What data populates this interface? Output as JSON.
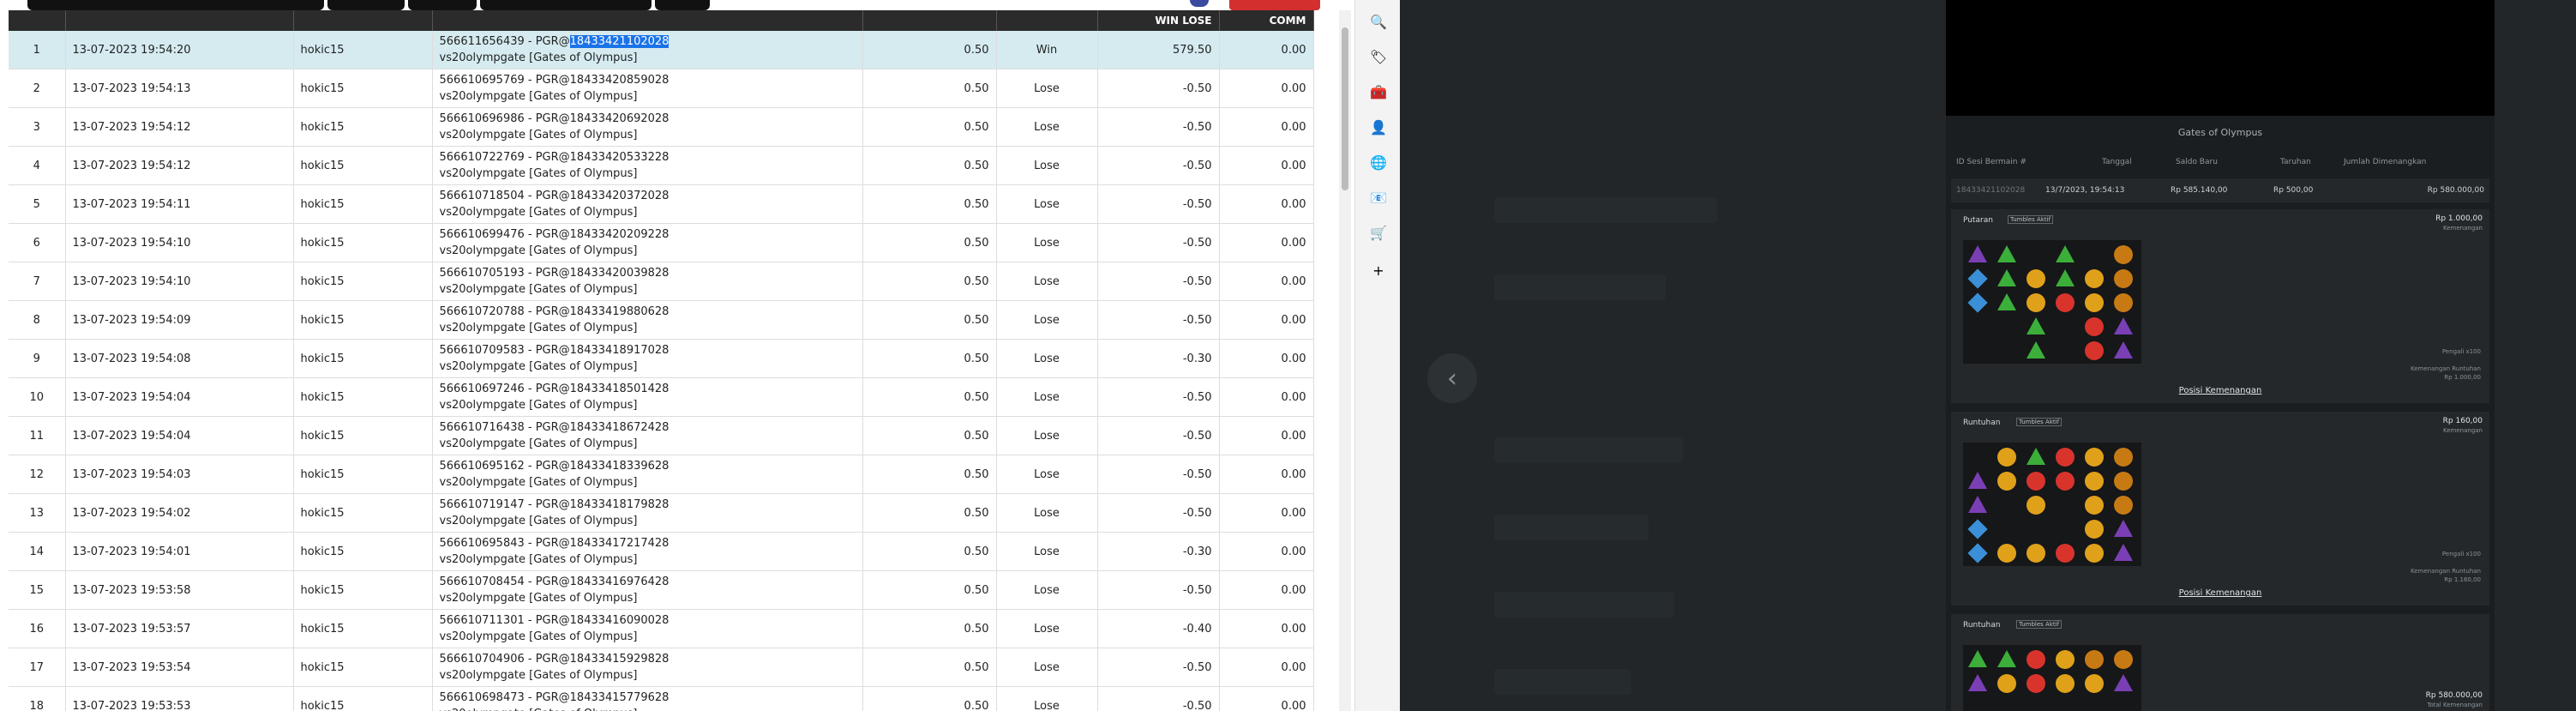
{
  "table": {
    "headers": {
      "no": "",
      "date": "",
      "user": "",
      "desc": "",
      "bet": "",
      "result": "",
      "win_lose": "WIN LOSE",
      "comm": "COMM"
    },
    "rows": [
      {
        "no": "1",
        "date": "13-07-2023 19:54:20",
        "user": "hokic15",
        "desc_pre": "566611656439 - PGR@",
        "desc_sel": "18433421102028",
        "desc_line2": "vs20olympgate [Gates of Olympus]",
        "bet": "0.50",
        "result": "Win",
        "win_lose": "579.50",
        "comm": "0.00"
      },
      {
        "no": "2",
        "date": "13-07-2023 19:54:13",
        "user": "hokic15",
        "desc_pre": "566610695769 - PGR@18433420859028",
        "desc_sel": "",
        "desc_line2": "vs20olympgate [Gates of Olympus]",
        "bet": "0.50",
        "result": "Lose",
        "win_lose": "-0.50",
        "comm": "0.00"
      },
      {
        "no": "3",
        "date": "13-07-2023 19:54:12",
        "user": "hokic15",
        "desc_pre": "566610696986 - PGR@18433420692028",
        "desc_sel": "",
        "desc_line2": "vs20olympgate [Gates of Olympus]",
        "bet": "0.50",
        "result": "Lose",
        "win_lose": "-0.50",
        "comm": "0.00"
      },
      {
        "no": "4",
        "date": "13-07-2023 19:54:12",
        "user": "hokic15",
        "desc_pre": "566610722769 - PGR@18433420533228",
        "desc_sel": "",
        "desc_line2": "vs20olympgate [Gates of Olympus]",
        "bet": "0.50",
        "result": "Lose",
        "win_lose": "-0.50",
        "comm": "0.00"
      },
      {
        "no": "5",
        "date": "13-07-2023 19:54:11",
        "user": "hokic15",
        "desc_pre": "566610718504 - PGR@18433420372028",
        "desc_sel": "",
        "desc_line2": "vs20olympgate [Gates of Olympus]",
        "bet": "0.50",
        "result": "Lose",
        "win_lose": "-0.50",
        "comm": "0.00"
      },
      {
        "no": "6",
        "date": "13-07-2023 19:54:10",
        "user": "hokic15",
        "desc_pre": "566610699476 - PGR@18433420209228",
        "desc_sel": "",
        "desc_line2": "vs20olympgate [Gates of Olympus]",
        "bet": "0.50",
        "result": "Lose",
        "win_lose": "-0.50",
        "comm": "0.00"
      },
      {
        "no": "7",
        "date": "13-07-2023 19:54:10",
        "user": "hokic15",
        "desc_pre": "566610705193 - PGR@18433420039828",
        "desc_sel": "",
        "desc_line2": "vs20olympgate [Gates of Olympus]",
        "bet": "0.50",
        "result": "Lose",
        "win_lose": "-0.50",
        "comm": "0.00"
      },
      {
        "no": "8",
        "date": "13-07-2023 19:54:09",
        "user": "hokic15",
        "desc_pre": "566610720788 - PGR@18433419880628",
        "desc_sel": "",
        "desc_line2": "vs20olympgate [Gates of Olympus]",
        "bet": "0.50",
        "result": "Lose",
        "win_lose": "-0.50",
        "comm": "0.00"
      },
      {
        "no": "9",
        "date": "13-07-2023 19:54:08",
        "user": "hokic15",
        "desc_pre": "566610709583 - PGR@18433418917028",
        "desc_sel": "",
        "desc_line2": "vs20olympgate [Gates of Olympus]",
        "bet": "0.50",
        "result": "Lose",
        "win_lose": "-0.30",
        "comm": "0.00"
      },
      {
        "no": "10",
        "date": "13-07-2023 19:54:04",
        "user": "hokic15",
        "desc_pre": "566610697246 - PGR@18433418501428",
        "desc_sel": "",
        "desc_line2": "vs20olympgate [Gates of Olympus]",
        "bet": "0.50",
        "result": "Lose",
        "win_lose": "-0.50",
        "comm": "0.00"
      },
      {
        "no": "11",
        "date": "13-07-2023 19:54:04",
        "user": "hokic15",
        "desc_pre": "566610716438 - PGR@18433418672428",
        "desc_sel": "",
        "desc_line2": "vs20olympgate [Gates of Olympus]",
        "bet": "0.50",
        "result": "Lose",
        "win_lose": "-0.50",
        "comm": "0.00"
      },
      {
        "no": "12",
        "date": "13-07-2023 19:54:03",
        "user": "hokic15",
        "desc_pre": "566610695162 - PGR@18433418339628",
        "desc_sel": "",
        "desc_line2": "vs20olympgate [Gates of Olympus]",
        "bet": "0.50",
        "result": "Lose",
        "win_lose": "-0.50",
        "comm": "0.00"
      },
      {
        "no": "13",
        "date": "13-07-2023 19:54:02",
        "user": "hokic15",
        "desc_pre": "566610719147 - PGR@18433418179828",
        "desc_sel": "",
        "desc_line2": "vs20olympgate [Gates of Olympus]",
        "bet": "0.50",
        "result": "Lose",
        "win_lose": "-0.50",
        "comm": "0.00"
      },
      {
        "no": "14",
        "date": "13-07-2023 19:54:01",
        "user": "hokic15",
        "desc_pre": "566610695843 - PGR@18433417217428",
        "desc_sel": "",
        "desc_line2": "vs20olympgate [Gates of Olympus]",
        "bet": "0.50",
        "result": "Lose",
        "win_lose": "-0.30",
        "comm": "0.00"
      },
      {
        "no": "15",
        "date": "13-07-2023 19:53:58",
        "user": "hokic15",
        "desc_pre": "566610708454 - PGR@18433416976428",
        "desc_sel": "",
        "desc_line2": "vs20olympgate [Gates of Olympus]",
        "bet": "0.50",
        "result": "Lose",
        "win_lose": "-0.50",
        "comm": "0.00"
      },
      {
        "no": "16",
        "date": "13-07-2023 19:53:57",
        "user": "hokic15",
        "desc_pre": "566610711301 - PGR@18433416090028",
        "desc_sel": "",
        "desc_line2": "vs20olympgate [Gates of Olympus]",
        "bet": "0.50",
        "result": "Lose",
        "win_lose": "-0.40",
        "comm": "0.00"
      },
      {
        "no": "17",
        "date": "13-07-2023 19:53:54",
        "user": "hokic15",
        "desc_pre": "566610704906 - PGR@18433415929828",
        "desc_sel": "",
        "desc_line2": "vs20olympgate [Gates of Olympus]",
        "bet": "0.50",
        "result": "Lose",
        "win_lose": "-0.50",
        "comm": "0.00"
      },
      {
        "no": "18",
        "date": "13-07-2023 19:53:53",
        "user": "hokic15",
        "desc_pre": "566610698473 - PGR@18433415779628",
        "desc_sel": "",
        "desc_line2": "vs20olympgate [Gates of Olympus]",
        "bet": "0.50",
        "result": "Lose",
        "win_lose": "-0.50",
        "comm": "0.00"
      }
    ]
  },
  "extensions": [
    {
      "name": "search-icon",
      "glyph": "🔍"
    },
    {
      "name": "tag-icon",
      "glyph": "🏷"
    },
    {
      "name": "briefcase-icon",
      "glyph": "🧰"
    },
    {
      "name": "person-icon",
      "glyph": "👤"
    },
    {
      "name": "world-icon",
      "glyph": "🌐"
    },
    {
      "name": "outlook-icon",
      "glyph": "📧"
    },
    {
      "name": "cart-icon",
      "glyph": "🛒"
    },
    {
      "name": "add-icon",
      "glyph": "+"
    }
  ],
  "game": {
    "title": "Gates of Olympus",
    "headers": {
      "round_id": "ID Sesi Bermain #",
      "date": "Tanggal",
      "balance": "Saldo Baru",
      "bet": "Taruhan",
      "win_total": "Jumlah Dimenangkan"
    },
    "round": {
      "round_id": "18433421102028",
      "date": "13/7/2023, 19:54:13",
      "balance": "Rp 585.140,00",
      "bet": "Rp 500,00",
      "win_total": "Rp 580.000,00"
    },
    "cards": [
      {
        "label": "Putaran",
        "badge": "Tumbles Aktif",
        "amount": "Rp 1.000,00",
        "amount_sub": "Kemenangan",
        "side1": "Pengali x100",
        "side2": "Kemenangan Runtuhan",
        "side3": "Rp 1.000,00",
        "link": "Posisi Kemenangan"
      },
      {
        "label": "Runtuhan",
        "badge": "Tumbles Aktif",
        "amount": "Rp 160,00",
        "amount_sub": "Kemenangan",
        "side1": "Pengali x100",
        "side2": "Kemenangan Runtuhan",
        "side3": "Rp 1.160,00",
        "link": "Posisi Kemenangan"
      },
      {
        "label": "Runtuhan",
        "badge": "Tumbles Aktif",
        "amount": "Rp 580.000,00",
        "amount_sub": "Total Kemenangan",
        "side1": "",
        "side2": "",
        "side3": "",
        "link": ""
      }
    ]
  },
  "colors": {
    "win": "#2e7d32",
    "lose": "#e53935",
    "highlight": "#d5ebf0",
    "header_bg": "#2b2b2b"
  }
}
